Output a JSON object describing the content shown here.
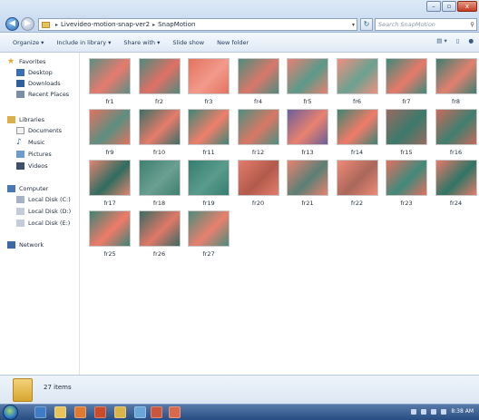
{
  "window": {
    "controls": [
      "–",
      "▫",
      "x"
    ]
  },
  "address": {
    "segments": [
      "Livevideo-motion-snap-ver2",
      "SnapMotion"
    ],
    "search_placeholder": "Search SnapMotion"
  },
  "toolbar": {
    "organize": "Organize ▾",
    "include": "Include in library ▾",
    "share": "Share with ▾",
    "slideshow": "Slide show",
    "newfolder": "New folder"
  },
  "nav": {
    "favorites": "Favorites",
    "desktop": "Desktop",
    "downloads": "Downloads",
    "recent": "Recent Places",
    "libraries": "Libraries",
    "documents": "Documents",
    "music": "Music",
    "pictures": "Pictures",
    "videos": "Videos",
    "computer": "Computer",
    "diskc": "Local Disk (C:)",
    "diskd": "Local Disk (D:)",
    "diske": "Local Disk (E:)",
    "network": "Network"
  },
  "files": [
    {
      "name": "fr1",
      "c1": "#5a8f82",
      "c2": "#e87a6e"
    },
    {
      "name": "fr2",
      "c1": "#4f8a7c",
      "c2": "#e07066"
    },
    {
      "name": "fr3",
      "c1": "#e2735f",
      "c2": "#f39a8c"
    },
    {
      "name": "fr4",
      "c1": "#4e8c7e",
      "c2": "#d8786a"
    },
    {
      "name": "fr5",
      "c1": "#e88070",
      "c2": "#5a9a8a"
    },
    {
      "name": "fr6",
      "c1": "#f08f80",
      "c2": "#6aa291"
    },
    {
      "name": "fr7",
      "c1": "#3e8a7a",
      "c2": "#e77a6a"
    },
    {
      "name": "fr8",
      "c1": "#3c7f71",
      "c2": "#e2806f"
    },
    {
      "name": "fr9",
      "c1": "#e2725f",
      "c2": "#5b8f81"
    },
    {
      "name": "fr10",
      "c1": "#3b6f66",
      "c2": "#e67c6b"
    },
    {
      "name": "fr11",
      "c1": "#3f8676",
      "c2": "#ef7f6b"
    },
    {
      "name": "fr12",
      "c1": "#4d8f80",
      "c2": "#d97765"
    },
    {
      "name": "fr13",
      "c1": "#6a5f9a",
      "c2": "#e9826f"
    },
    {
      "name": "fr14",
      "c1": "#3e8474",
      "c2": "#f07c68"
    },
    {
      "name": "fr15",
      "c1": "#9a6a60",
      "c2": "#3a7a6c"
    },
    {
      "name": "fr16",
      "c1": "#c86a5a",
      "c2": "#3f7f70"
    },
    {
      "name": "fr17",
      "c1": "#e2846f",
      "c2": "#2f6d60"
    },
    {
      "name": "fr18",
      "c1": "#3f8070",
      "c2": "#6a9f91"
    },
    {
      "name": "fr19",
      "c1": "#357e70",
      "c2": "#5a9b8c"
    },
    {
      "name": "fr20",
      "c1": "#e47c6c",
      "c2": "#b25a4c"
    },
    {
      "name": "fr21",
      "c1": "#e9836f",
      "c2": "#5a7f75"
    },
    {
      "name": "fr22",
      "c1": "#f08a78",
      "c2": "#a9675a"
    },
    {
      "name": "fr23",
      "c1": "#e2705e",
      "c2": "#3f8a7b"
    },
    {
      "name": "fr24",
      "c1": "#e67a68",
      "c2": "#2f7566"
    },
    {
      "name": "fr25",
      "c1": "#3c8575",
      "c2": "#f07a68"
    },
    {
      "name": "fr26",
      "c1": "#3a6b62",
      "c2": "#e07868"
    },
    {
      "name": "fr27",
      "c1": "#4c8c7c",
      "c2": "#e8806e"
    }
  ],
  "status": {
    "count": "27 items"
  },
  "taskbar": {
    "time": "8:38 AM"
  }
}
